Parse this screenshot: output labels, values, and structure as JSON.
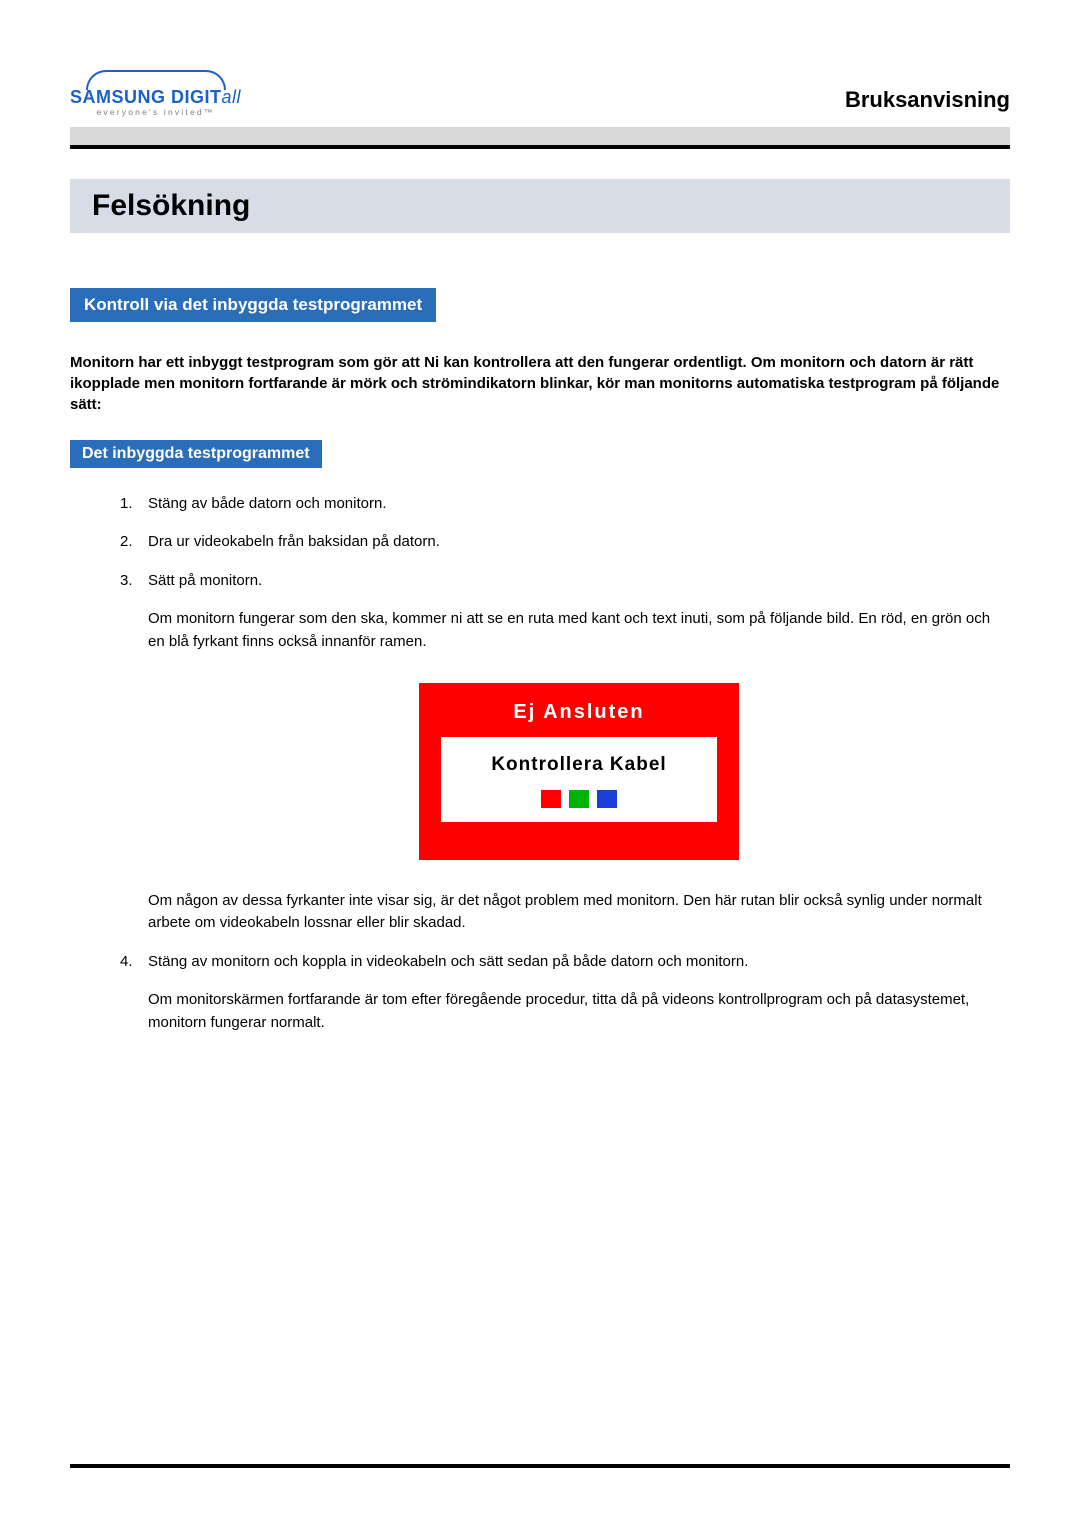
{
  "logo": {
    "main_a": "SAMSUNG DIGIT",
    "main_b": "all",
    "tagline": "everyone's invited™"
  },
  "doc_type": "Bruksanvisning",
  "page_title": "Felsökning",
  "section_heading": "Kontroll via det inbyggda testprogrammet",
  "intro": "Monitorn har ett inbyggt testprogram som gör att Ni kan kontrollera att den fungerar ordentligt. Om monitorn och datorn är rätt ikopplade men monitorn fortfarande är mörk och strömindikatorn blinkar, kör man monitorns automatiska testprogram på följande sätt:",
  "subsection_heading": "Det inbyggda testprogrammet",
  "steps": {
    "s1": "Stäng av både datorn och monitorn.",
    "s2": "Dra ur videokabeln från baksidan på datorn.",
    "s3": "Sätt på monitorn.",
    "s3_p1": "Om monitorn fungerar som den ska, kommer ni att se en ruta med kant och text inuti, som på följande bild. En röd, en grön och en blå fyrkant finns också innanför ramen.",
    "s3_p2": "Om någon av dessa fyrkanter inte visar sig, är det något problem med monitorn. Den här rutan blir också synlig under normalt arbete om videokabeln lossnar eller blir skadad.",
    "s4": "Stäng av monitorn och koppla in videokabeln och sätt sedan på både datorn och monitorn.",
    "s4_p1": "Om monitorskärmen fortfarande är tom efter föregående procedur, titta då på videons kontrollprogram och på datasystemet, monitorn fungerar normalt."
  },
  "diagram": {
    "top": "Ej Ansluten",
    "mid": "Kontrollera Kabel",
    "colors": {
      "red": "#ff0000",
      "green": "#00b300",
      "blue": "#1a3fd9"
    }
  }
}
